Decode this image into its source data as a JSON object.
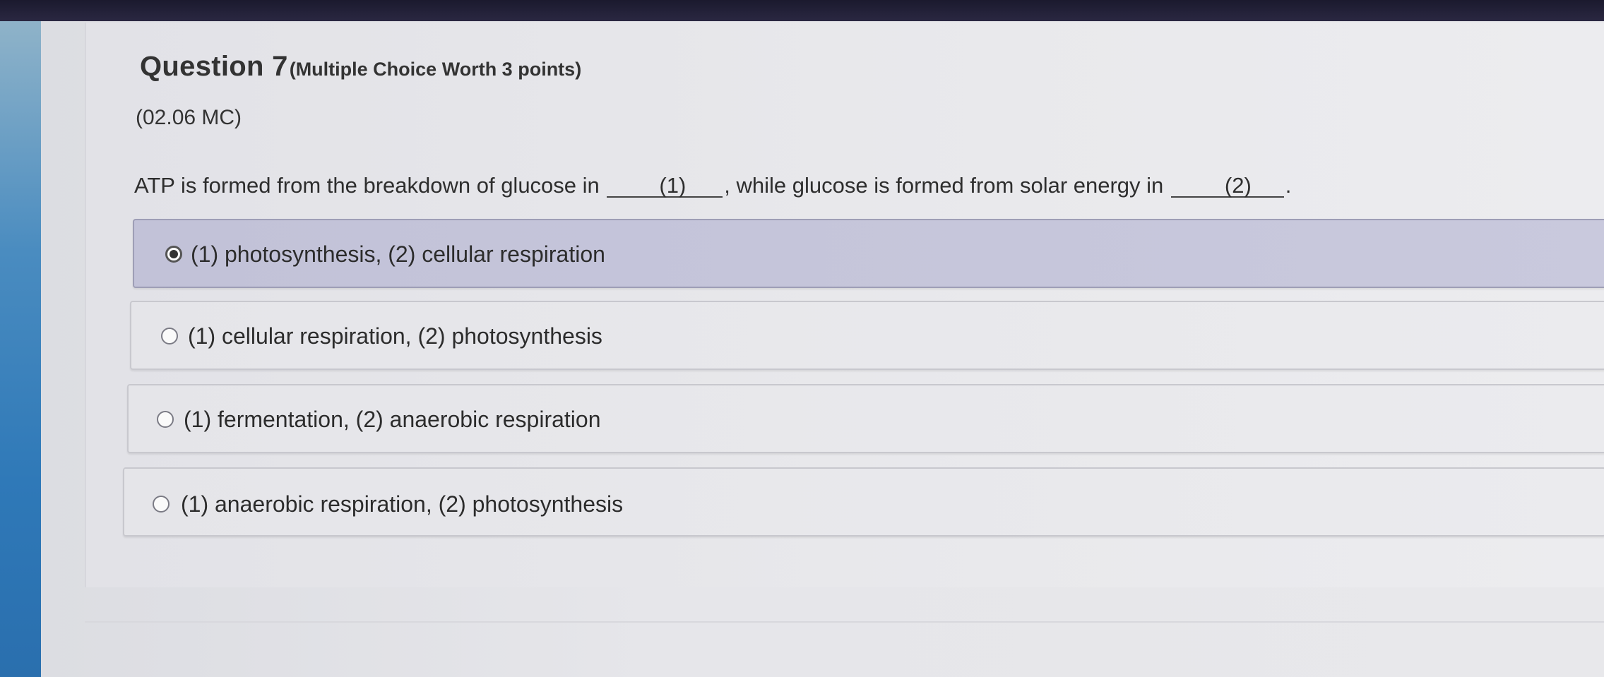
{
  "question": {
    "title": "Question 7",
    "subtitle": "(Multiple Choice Worth 3 points)",
    "code": "(02.06 MC)",
    "stem_part1": "ATP is formed from the breakdown of glucose in",
    "blank1": "(1)",
    "stem_part2": ", while glucose is formed from solar energy in",
    "blank2": "(2)",
    "stem_end": "."
  },
  "options": [
    {
      "label": "(1) photosynthesis, (2) cellular respiration",
      "selected": true
    },
    {
      "label": "(1) cellular respiration, (2) photosynthesis",
      "selected": false
    },
    {
      "label": "(1) fermentation, (2) anaerobic respiration",
      "selected": false
    },
    {
      "label": "(1) anaerobic respiration, (2) photosynthesis",
      "selected": false
    }
  ],
  "colors": {
    "selected_option_bg": "#c5c5da",
    "option_bg": "#e8e8eb",
    "text": "#2c2c2c"
  }
}
